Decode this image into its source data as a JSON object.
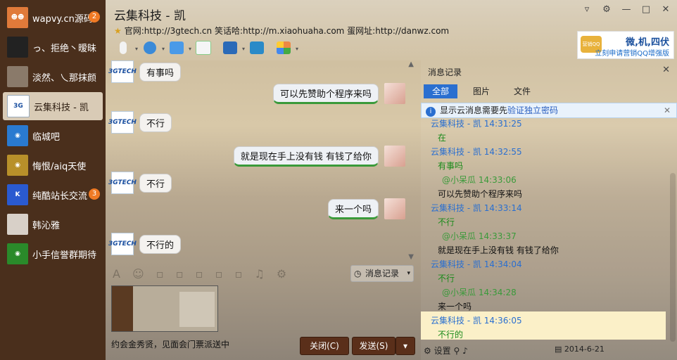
{
  "sidebar": {
    "items": [
      {
        "label": "wapvy.cn源码",
        "badge": "2",
        "avatar": "people"
      },
      {
        "label": "っ、拒绝丶暧昧",
        "badge": "",
        "avatar": "photo"
      },
      {
        "label": "淡然、乀那抹颜",
        "badge": "",
        "avatar": "photo"
      },
      {
        "label": "云集科技 - 凯",
        "badge": "",
        "avatar": "3gtech"
      },
      {
        "label": "临城吧",
        "badge": "",
        "avatar": "group"
      },
      {
        "label": "悔恨/aiq天使",
        "badge": "",
        "avatar": "group"
      },
      {
        "label": "纯酷站长交流",
        "badge": "3",
        "avatar": "group"
      },
      {
        "label": "韩沁雅",
        "badge": "",
        "avatar": "photo"
      },
      {
        "label": "小手信誉群期待",
        "badge": "",
        "avatar": "group"
      }
    ]
  },
  "header": {
    "title": "云集科技 - 凯",
    "subtitle": "官网:http://3gtech.cn 笑话哈:http://m.xiaohuaha.com 蛋网址:http://danwz.com",
    "ad_line1": "微,机,四伏",
    "ad_line2": "立刻申请营销QQ增强版",
    "ad_logo": "营销QQ"
  },
  "chat": {
    "avatar_text": "3GTECH",
    "messages": [
      {
        "side": "left",
        "text": "有事吗"
      },
      {
        "side": "right",
        "text": "可以先赞助个程序来吗"
      },
      {
        "side": "left",
        "text": "不行"
      },
      {
        "side": "right",
        "text": "就是现在手上没有钱   有钱了给你"
      },
      {
        "side": "left",
        "text": "不行"
      },
      {
        "side": "right",
        "text": "来一个吗"
      },
      {
        "side": "left",
        "text": "不行的"
      }
    ]
  },
  "composer": {
    "history_button": "消息记录",
    "input_text": "约会金秀贤，见面会门票派送中",
    "close_button": "关闭(C)",
    "send_button": "发送(S)"
  },
  "history": {
    "title": "消息记录",
    "tabs": [
      "全部",
      "图片",
      "文件"
    ],
    "notice_text": "显示云消息需要先",
    "notice_link": "验证独立密码",
    "rows": [
      {
        "kind": "s1",
        "text": "云集科技 - 凯 14:31:25"
      },
      {
        "kind": "t2",
        "text": "在"
      },
      {
        "kind": "s1",
        "text": "云集科技 - 凯 14:32:55"
      },
      {
        "kind": "t2",
        "text": "有事吗"
      },
      {
        "kind": "s2",
        "text": "@小呆瓜 14:33:06"
      },
      {
        "kind": "t",
        "text": "可以先赞助个程序来吗"
      },
      {
        "kind": "s1",
        "text": "云集科技 - 凯 14:33:14"
      },
      {
        "kind": "t2",
        "text": "不行"
      },
      {
        "kind": "s2",
        "text": "@小呆瓜 14:33:37"
      },
      {
        "kind": "t",
        "text": "就是现在手上没有钱    有钱了给你"
      },
      {
        "kind": "s1",
        "text": "云集科技 - 凯 14:34:04"
      },
      {
        "kind": "t2",
        "text": "不行"
      },
      {
        "kind": "s2",
        "text": "@小呆瓜 14:34:28"
      },
      {
        "kind": "t",
        "text": "来一个吗"
      },
      {
        "kind": "s1",
        "text": "云集科技 - 凯 14:36:05"
      },
      {
        "kind": "t2",
        "text": "不行的"
      }
    ],
    "settings_label": "设置",
    "date": "2014-6-21"
  },
  "colors": {
    "sidebar": "#4a2f1c",
    "accent": "#2a6fd0",
    "button": "#5a2f1a",
    "highlight": "#fbf0c8"
  }
}
